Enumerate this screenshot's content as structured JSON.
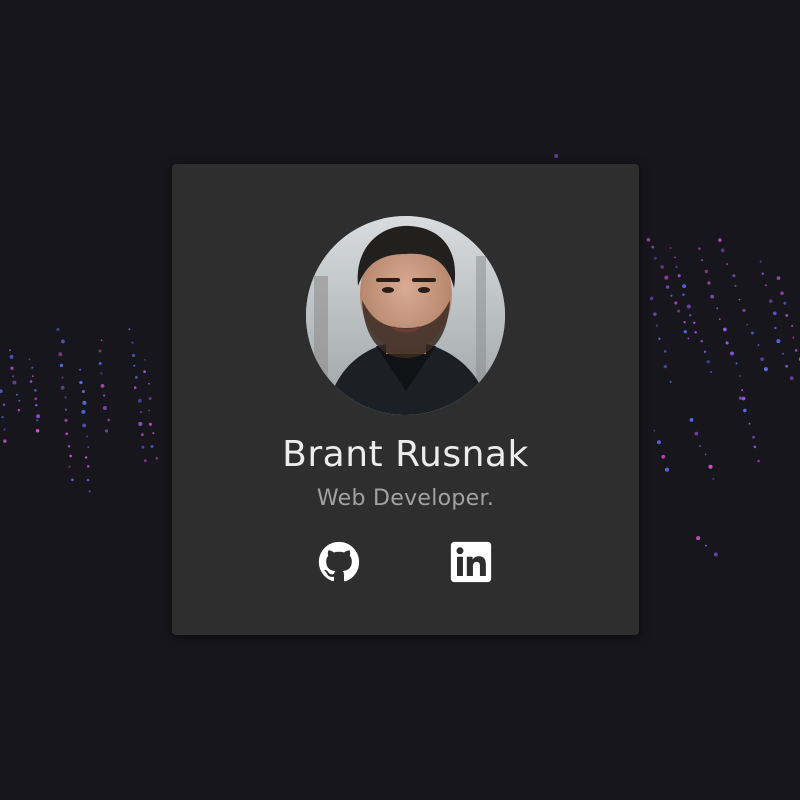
{
  "profile": {
    "name": "Brant Rusnak",
    "role": "Web Developer."
  },
  "social": {
    "github": {
      "icon": "github-icon"
    },
    "linkedin": {
      "icon": "linkedin-icon"
    }
  },
  "colors": {
    "background": "#16161c",
    "card": "#2e2e2e",
    "name_text": "#ececec",
    "role_text": "#a2a2a2",
    "icon": "#ffffff",
    "particle_pink": "#d44fd6",
    "particle_blue": "#5a6bf0",
    "particle_violet": "#9b5cf2"
  }
}
